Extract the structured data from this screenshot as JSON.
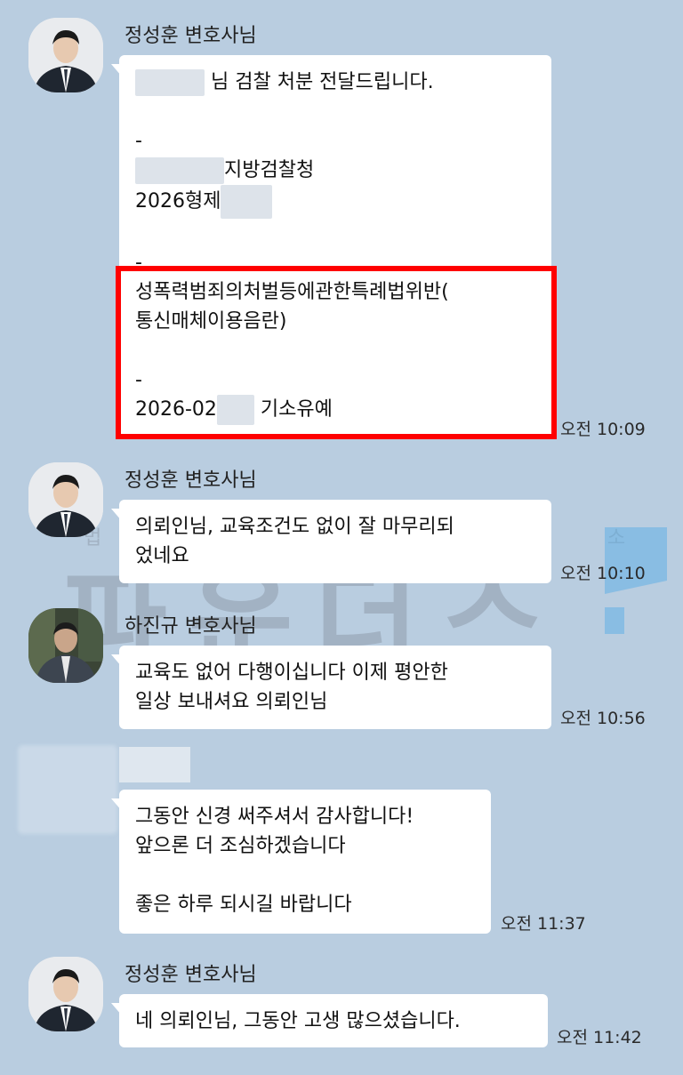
{
  "messages": [
    {
      "sender": "정성훈 변호사님",
      "avatar": "lawyer-jung-avatar",
      "lines": [
        "님 검찰 처분 전달드립니다.",
        "",
        "-",
        "지방검찰청",
        "2026형제",
        "",
        "-",
        "성폭력범죄의처벌등에관한특례법위반(",
        "통신매체이용음란)",
        "",
        "-",
        "2026-02",
        "기소유예"
      ],
      "time": "오전 10:09"
    },
    {
      "sender": "정성훈 변호사님",
      "avatar": "lawyer-jung-avatar",
      "lines": [
        "의뢰인님, 교육조건도 없이 잘 마무리되",
        "었네요"
      ],
      "time": "오전 10:10"
    },
    {
      "sender": "하진규 변호사님",
      "avatar": "lawyer-ha-avatar",
      "lines": [
        "교육도 없어 다행이십니다 이제 평안한",
        "일상 보내셔요 의뢰인님"
      ],
      "time": "오전 10:56"
    },
    {
      "sender": "",
      "avatar": "blurred-client-avatar",
      "lines": [
        "그동안 신경 써주셔서 감사합니다!",
        "앞으론 더 조심하겠습니다",
        "",
        "좋은 하루 되시길 바랍니다"
      ],
      "time": "오전 11:37"
    },
    {
      "sender": "정성훈 변호사님",
      "avatar": "lawyer-jung-avatar",
      "lines": [
        "네 의뢰인님, 그동안 고생 많으셨습니다."
      ],
      "time": "오전 11:42"
    }
  ],
  "watermark": {
    "text": "파운더스",
    "small_text": "법 률 사 무 소"
  },
  "colors": {
    "background": "#b9cde0",
    "bubble": "#ffffff",
    "highlight_box": "#ff0000"
  }
}
